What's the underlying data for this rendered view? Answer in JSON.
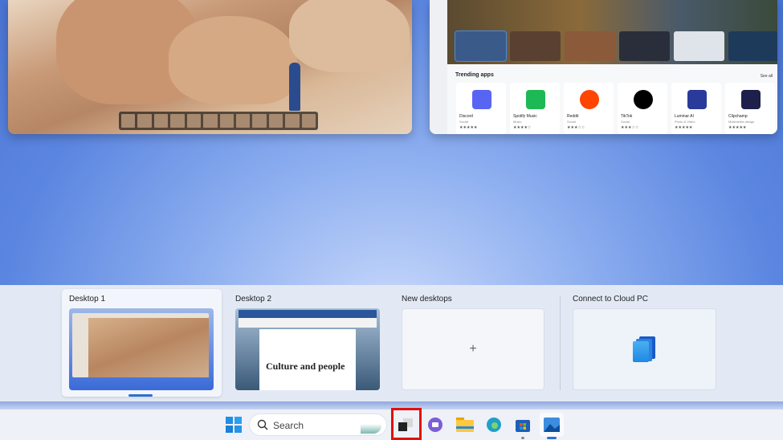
{
  "store": {
    "section_title": "Trending apps",
    "see_all": "See all",
    "apps": [
      {
        "name": "Discord",
        "category": "Social",
        "rating": "★★★★★",
        "icon": "discord-icon",
        "color": "#5865f2"
      },
      {
        "name": "Spotify Music",
        "category": "Music",
        "rating": "★★★★☆",
        "icon": "spotify-icon",
        "color": "#1db954"
      },
      {
        "name": "Reddit",
        "category": "Social",
        "rating": "★★★☆☆",
        "icon": "reddit-icon",
        "color": "#ff4500"
      },
      {
        "name": "TikTok",
        "category": "Social",
        "rating": "★★★☆☆",
        "icon": "tiktok-icon",
        "color": "#000000"
      },
      {
        "name": "Luminar AI",
        "category": "Photo & Video",
        "rating": "★★★★★",
        "icon": "luminar-icon",
        "color": "#2a3a9a"
      },
      {
        "name": "Clipchamp",
        "category": "Multimedia design",
        "rating": "★★★★★",
        "icon": "clipchamp-icon",
        "color": "#1e1f4a"
      }
    ]
  },
  "desktops": {
    "items": [
      {
        "label": "Desktop 1",
        "active": true
      },
      {
        "label": "Desktop 2",
        "active": false,
        "doc_text": "Culture and people"
      }
    ],
    "new_label": "New desktops",
    "new_symbol": "+",
    "cloud_label": "Connect to Cloud PC"
  },
  "taskbar": {
    "search_placeholder": "Search",
    "apps": [
      "start-icon",
      "task-view-icon",
      "teams-chat-icon",
      "file-explorer-icon",
      "edge-icon",
      "store-icon",
      "photos-icon"
    ],
    "highlight_color": "#e01010"
  }
}
